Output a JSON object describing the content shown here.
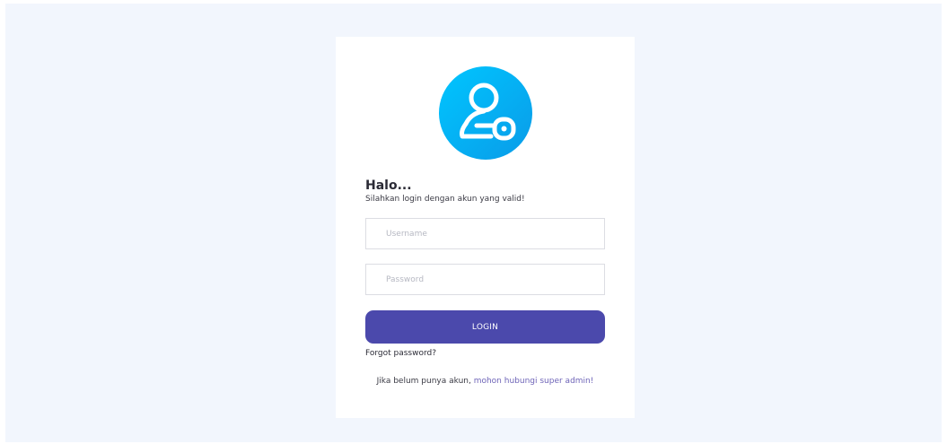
{
  "login": {
    "logo_icon": "user-key-icon",
    "title": "Halo...",
    "subtitle": "Silahkan login dengan akun yang valid!",
    "username_placeholder": "Username",
    "password_placeholder": "Password",
    "login_label": "LOGIN",
    "forgot_label": "Forgot password?",
    "signup_text": "Jika belum punya akun, ",
    "signup_link": "mohon hubungi super admin!"
  },
  "colors": {
    "accent": "#4b49ac",
    "page_background": "#f2f6fd",
    "logo_gradient_start": "#00c6ff",
    "logo_gradient_end": "#0a9be8"
  }
}
